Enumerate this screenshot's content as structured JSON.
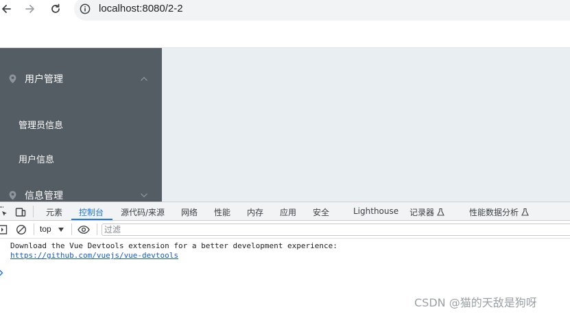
{
  "browser": {
    "url": "localhost:8080/2-2"
  },
  "sidebar": {
    "menus": [
      {
        "label": "用户管理",
        "expanded": true
      },
      {
        "label": "信息管理",
        "expanded": false
      }
    ],
    "sub_items": [
      "管理员信息",
      "用户信息"
    ]
  },
  "devtools": {
    "tabs": [
      {
        "label": "元素"
      },
      {
        "label": "控制台",
        "active": true
      },
      {
        "label": "源代码/来源"
      },
      {
        "label": "网络"
      },
      {
        "label": "性能"
      },
      {
        "label": "内存"
      },
      {
        "label": "应用"
      },
      {
        "label": "安全"
      },
      {
        "label": "Lighthouse"
      },
      {
        "label": "记录器"
      },
      {
        "label": "性能数据分析"
      }
    ],
    "context": "top",
    "filter_placeholder": "过滤",
    "console": {
      "message": "Download the Vue Devtools extension for a better development experience:",
      "link": "https://github.com/vuejs/vue-devtools"
    }
  },
  "watermark": "CSDN @猫的天敌是狗呀",
  "colors": {
    "sidebar_bg": "#545c64",
    "content_bg": "#e9eef3",
    "devtools_accent": "#1a73e8"
  }
}
